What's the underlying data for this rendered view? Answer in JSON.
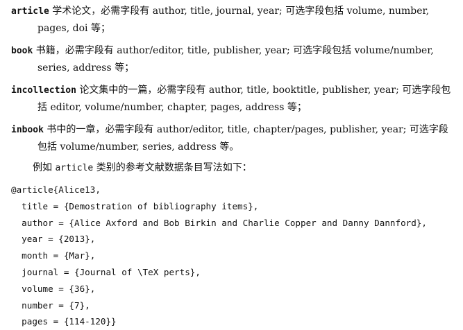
{
  "entries": [
    {
      "keyword": "article",
      "text": " 学术论文，必需字段有 author, title, journal, year; 可选字段包括 volume, number, pages, doi 等；"
    },
    {
      "keyword": "book",
      "text": " 书籍，必需字段有 author/editor, title, publisher, year; 可选字段包括 volume/number, series, address 等；"
    },
    {
      "keyword": "incollection",
      "text": " 论文集中的一篇，必需字段有 author, title, booktitle, publisher, year; 可选字段包括 editor, volume/number, chapter, pages, address 等；"
    },
    {
      "keyword": "inbook",
      "text": " 书中的一章，必需字段有 author/editor, title, chapter/pages, publisher, year; 可选字段包括 volume/number, series, address 等。"
    }
  ],
  "intro": {
    "prefix": "例如 ",
    "keyword": "article",
    "suffix": " 类别的参考文献数据条目写法如下："
  },
  "code_lines": [
    "@article{Alice13,",
    "  title = {Demostration of bibliography items},",
    "  author = {Alice Axford and Bob Birkin and Charlie Copper and Danny Dannford},",
    "  year = {2013},",
    "  month = {Mar},",
    "  journal = {Journal of \\TeX perts},",
    "  volume = {36},",
    "  number = {7},",
    "  pages = {114-120}}"
  ]
}
